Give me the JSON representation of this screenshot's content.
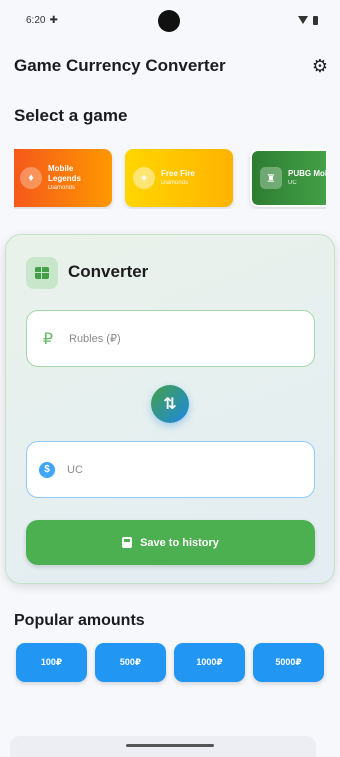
{
  "status_bar": {
    "time": "6:20",
    "extra_icon": "✚"
  },
  "app": {
    "title": "Game Currency Converter"
  },
  "icons": {
    "settings": "gear-icon",
    "rubles": "ruble-icon",
    "uc": "dollar-icon",
    "swap": "swap-icon",
    "save": "save-icon"
  },
  "games_section": {
    "title": "Select a game"
  },
  "games": [
    {
      "name": "Mobile Legends",
      "currency": "Diamonds"
    },
    {
      "name": "Free Fire",
      "currency": "Diamonds"
    },
    {
      "name": "PUBG Mobile",
      "currency": "UC"
    }
  ],
  "converter": {
    "title": "Converter",
    "rubles_placeholder": "Rubles (₽)",
    "uc_placeholder": "UC",
    "swap_symbol": "⇅",
    "save_label": "Save to history"
  },
  "popular": {
    "title": "Popular amounts",
    "amounts": [
      "100₽",
      "500₽",
      "1000₽",
      "5000₽"
    ]
  },
  "colors": {
    "accent_green": "#4caf50",
    "accent_blue": "#2196f3",
    "card_ml": "#f4511e",
    "card_ff": "#ffc107",
    "card_pubg": "#2e7d32"
  }
}
